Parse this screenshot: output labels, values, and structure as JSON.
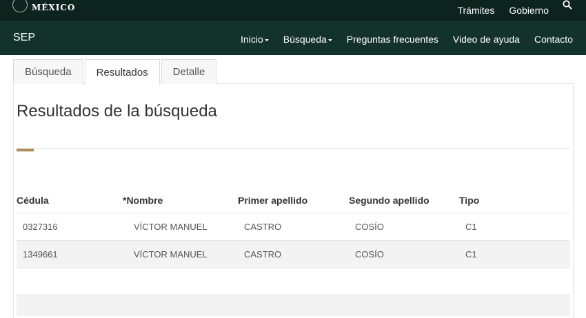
{
  "top_bar": {
    "logo_text": "MÉXICO",
    "links": [
      "Trámites",
      "Gobierno"
    ],
    "search_icon": "search-icon"
  },
  "main_nav": {
    "brand": "SEP",
    "items": [
      {
        "label": "Inicio",
        "dropdown": true
      },
      {
        "label": "Búsqueda",
        "dropdown": true
      },
      {
        "label": "Preguntas frecuentes",
        "dropdown": false
      },
      {
        "label": "Video de ayuda",
        "dropdown": false
      },
      {
        "label": "Contacto",
        "dropdown": false
      }
    ]
  },
  "tabs": [
    {
      "label": "Búsqueda",
      "active": false
    },
    {
      "label": "Resultados",
      "active": true
    },
    {
      "label": "Detalle",
      "active": false
    }
  ],
  "page_title": "Resultados de la búsqueda",
  "table": {
    "columns": [
      "Cédula",
      "*Nombre",
      "Primer apellido",
      "Segundo apellido",
      "Tipo"
    ],
    "rows": [
      [
        "0327316",
        "VÍCTOR MANUEL",
        "CASTRO",
        "COSÍO",
        "C1"
      ],
      [
        "1349661",
        "VÍCTOR MANUEL",
        "CASTRO",
        "COSÍO",
        "C1"
      ]
    ]
  },
  "colors": {
    "top_bar": "#0c231e",
    "nav_bar": "#13322b",
    "accent": "#b38e5d"
  }
}
